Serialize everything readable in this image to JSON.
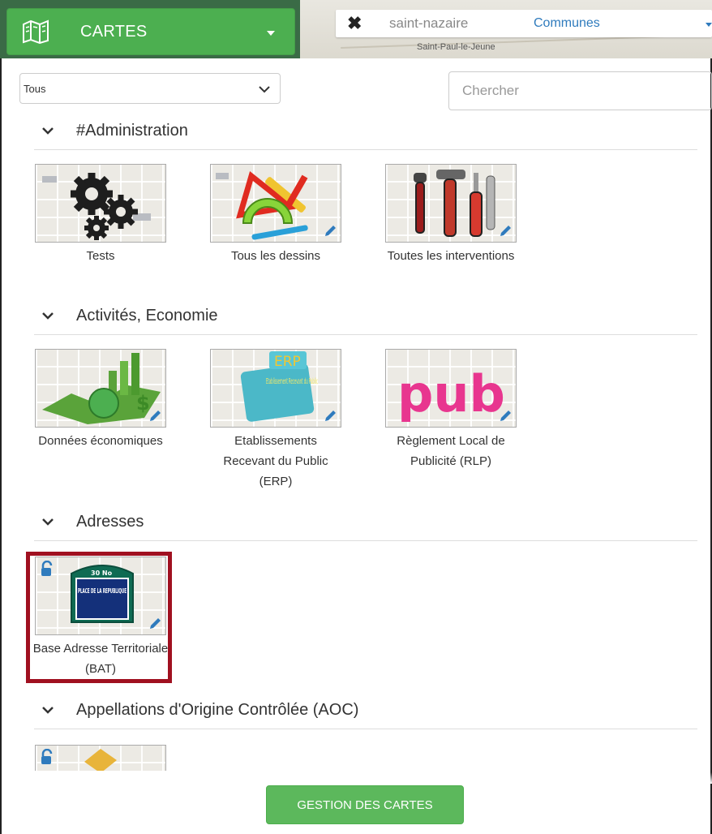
{
  "header": {
    "cartes_label": "CARTES",
    "search_value": "saint-nazaire",
    "search_scope": "Communes",
    "map_place_label": "Saint-Paul-le-Jeune"
  },
  "filters": {
    "category_selected": "Tous",
    "search_placeholder": "Chercher"
  },
  "sections": [
    {
      "title": "#Administration",
      "items": [
        {
          "label": "Tests",
          "icon": "gears-icon"
        },
        {
          "label": "Tous les dessins",
          "icon": "drawing-tools-icon"
        },
        {
          "label": "Toutes les interventions",
          "icon": "tools-icon"
        }
      ]
    },
    {
      "title": "Activités, Economie",
      "items": [
        {
          "label": "Données économiques",
          "icon": "economy-icon"
        },
        {
          "label": "Etablissements Recevant du Public (ERP)",
          "icon": "erp-icon",
          "thumb_text": "ERP",
          "thumb_subtext": "Etablissement Recevant du Public"
        },
        {
          "label": "Règlement Local de Publicité (RLP)",
          "icon": "pub-icon",
          "thumb_text": "pub"
        }
      ]
    },
    {
      "title": "Adresses",
      "items": [
        {
          "label": "Base Adresse Territoriale (BAT)",
          "icon": "street-sign-icon",
          "thumb_sign_top": "30 No",
          "thumb_sign": "PLACE DE LA REPUBLIQUE",
          "selected": true
        }
      ]
    },
    {
      "title": "Appellations d'Origine Contrôlée (AOC)",
      "items": [
        {
          "label": "",
          "icon": "aoc-icon"
        }
      ]
    }
  ],
  "footer": {
    "gestion_label": "GESTION DES CARTES"
  },
  "colors": {
    "primary_green": "#4caf50",
    "button_green": "#5cb85c",
    "link_blue": "#2f7bbd",
    "selected_red": "#a01020"
  }
}
